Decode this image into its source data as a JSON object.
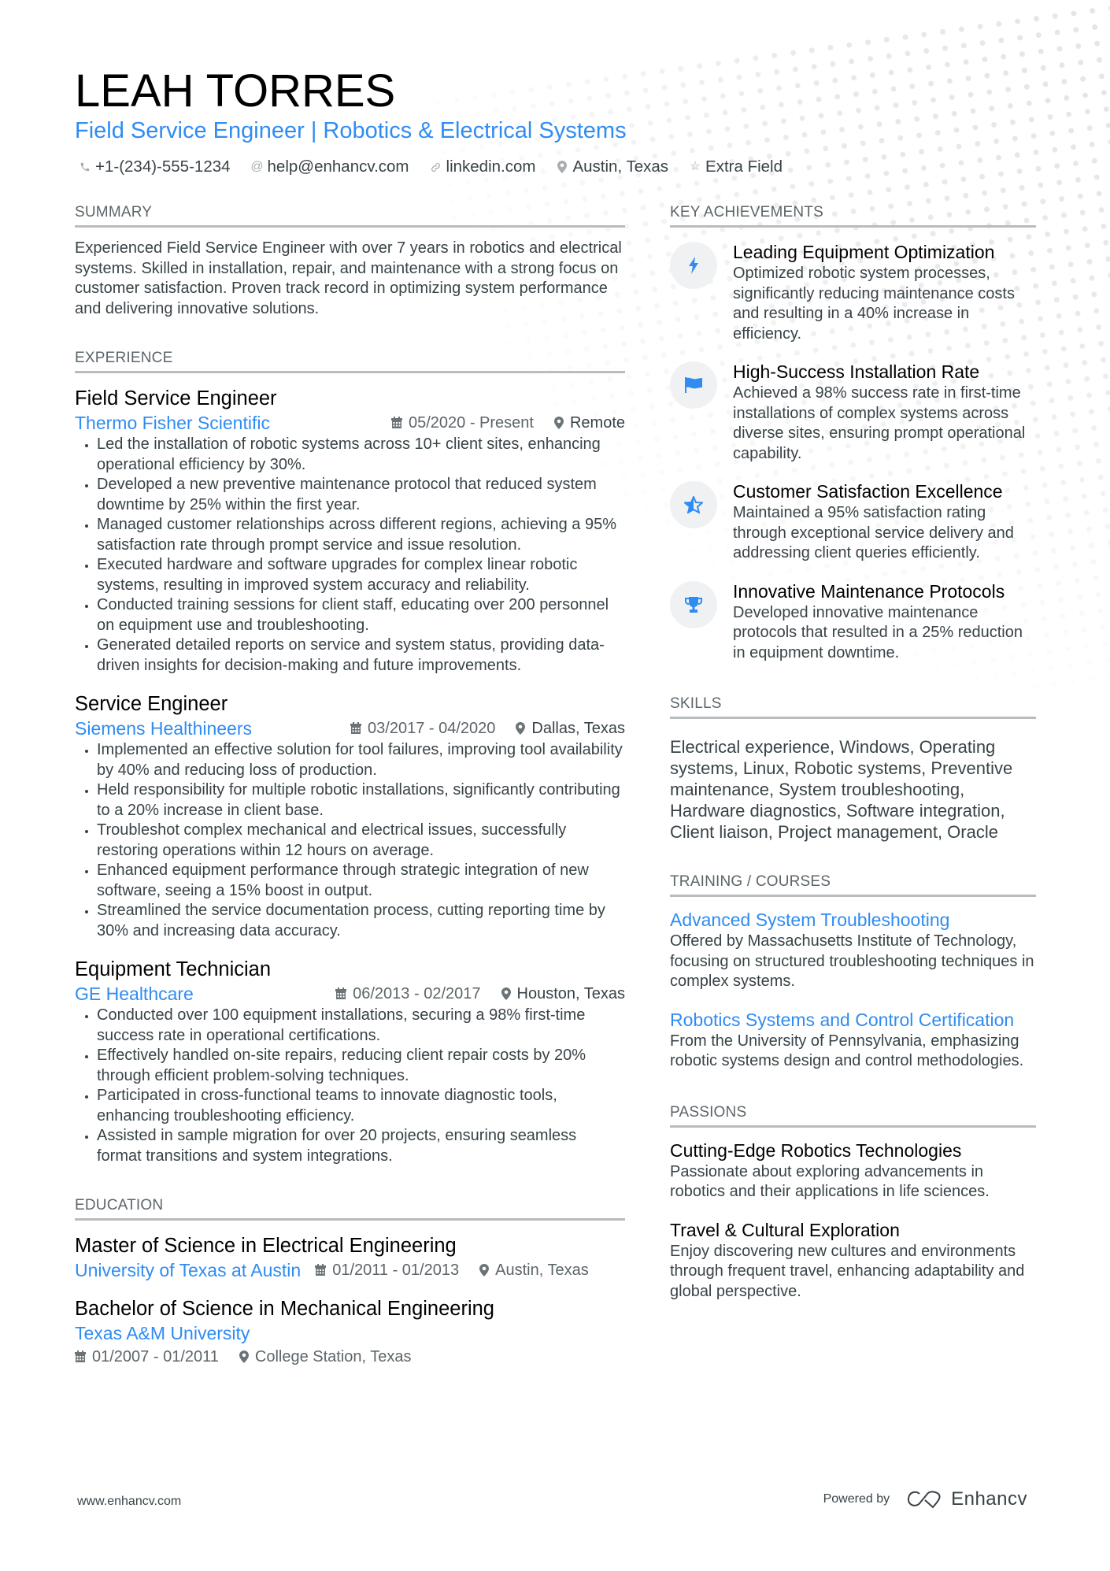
{
  "header": {
    "name": "LEAH TORRES",
    "title": "Field Service Engineer | Robotics & Electrical Systems",
    "contacts": [
      {
        "icon": "phone-icon",
        "text": "+1-(234)-555-1234"
      },
      {
        "icon": "at-icon",
        "text": "help@enhancv.com"
      },
      {
        "icon": "link-icon",
        "text": "linkedin.com"
      },
      {
        "icon": "location-pin-icon",
        "text": "Austin, Texas"
      },
      {
        "icon": "star-icon",
        "text": "Extra Field"
      }
    ]
  },
  "summary": {
    "heading": "SUMMARY",
    "text": "Experienced Field Service Engineer with over 7 years in robotics and electrical systems. Skilled in installation, repair, and maintenance with a strong focus on customer satisfaction. Proven track record in optimizing system performance and delivering innovative solutions."
  },
  "experience": {
    "heading": "EXPERIENCE",
    "jobs": [
      {
        "title": "Field Service Engineer",
        "company": "Thermo Fisher Scientific",
        "dates": "05/2020 - Present",
        "location": "Remote",
        "bullets": [
          "Led the installation of robotic systems across 10+ client sites, enhancing operational efficiency by 30%.",
          "Developed a new preventive maintenance protocol that reduced system downtime by 25% within the first year.",
          "Managed customer relationships across different regions, achieving a 95% satisfaction rate through prompt service and issue resolution.",
          "Executed hardware and software upgrades for complex linear robotic systems, resulting in improved system accuracy and reliability.",
          "Conducted training sessions for client staff, educating over 200 personnel on equipment use and troubleshooting.",
          "Generated detailed reports on service and system status, providing data-driven insights for decision-making and future improvements."
        ]
      },
      {
        "title": "Service Engineer",
        "company": "Siemens Healthineers",
        "dates": "03/2017 - 04/2020",
        "location": "Dallas, Texas",
        "bullets": [
          "Implemented an effective solution for tool failures, improving tool availability by 40% and reducing loss of production.",
          "Held responsibility for multiple robotic installations, significantly contributing to a 20% increase in client base.",
          "Troubleshot complex mechanical and electrical issues, successfully restoring operations within 12 hours on average.",
          "Enhanced equipment performance through strategic integration of new software, seeing a 15% boost in output.",
          "Streamlined the service documentation process, cutting reporting time by 30% and increasing data accuracy."
        ]
      },
      {
        "title": "Equipment Technician",
        "company": "GE Healthcare",
        "dates": "06/2013 - 02/2017",
        "location": "Houston, Texas",
        "bullets": [
          "Conducted over 100 equipment installations, securing a 98% first-time success rate in operational certifications.",
          "Effectively handled on-site repairs, reducing client repair costs by 20% through efficient problem-solving techniques.",
          "Participated in cross-functional teams to innovate diagnostic tools, enhancing troubleshooting efficiency.",
          "Assisted in sample migration for over 20 projects, ensuring seamless format transitions and system integrations."
        ]
      }
    ]
  },
  "education": {
    "heading": "EDUCATION",
    "items": [
      {
        "degree": "Master of Science in Electrical Engineering",
        "school": "University of Texas at Austin",
        "dates": "01/2011 - 01/2013",
        "location": "Austin, Texas"
      },
      {
        "degree": "Bachelor of Science in Mechanical Engineering",
        "school": "Texas A&M University",
        "dates": "01/2007 - 01/2011",
        "location": "College Station, Texas"
      }
    ]
  },
  "achievements": {
    "heading": "KEY ACHIEVEMENTS",
    "items": [
      {
        "icon": "lightning-bolt-icon",
        "title": "Leading Equipment Optimization",
        "desc": "Optimized robotic system processes, significantly reducing maintenance costs and resulting in a 40% increase in efficiency."
      },
      {
        "icon": "flag-icon",
        "title": "High-Success Installation Rate",
        "desc": "Achieved a 98% success rate in first-time installations of complex systems across diverse sites, ensuring prompt operational capability."
      },
      {
        "icon": "half-star-icon",
        "title": "Customer Satisfaction Excellence",
        "desc": "Maintained a 95% satisfaction rating through exceptional service delivery and addressing client queries efficiently."
      },
      {
        "icon": "trophy-icon",
        "title": "Innovative Maintenance Protocols",
        "desc": "Developed innovative maintenance protocols that resulted in a 25% reduction in equipment downtime."
      }
    ]
  },
  "skills": {
    "heading": "SKILLS",
    "text": "Electrical experience, Windows, Operating systems, Linux, Robotic systems, Preventive maintenance, System troubleshooting, Hardware diagnostics, Software integration, Client liaison, Project management, Oracle"
  },
  "training": {
    "heading": "TRAINING / COURSES",
    "items": [
      {
        "title": "Advanced System Troubleshooting",
        "desc": "Offered by Massachusetts Institute of Technology, focusing on structured troubleshooting techniques in complex systems."
      },
      {
        "title": "Robotics Systems and Control Certification",
        "desc": "From the University of Pennsylvania, emphasizing robotic systems design and control methodologies."
      }
    ]
  },
  "passions": {
    "heading": "PASSIONS",
    "items": [
      {
        "title": "Cutting-Edge Robotics Technologies",
        "desc": "Passionate about exploring advancements in robotics and their applications in life sciences."
      },
      {
        "title": "Travel & Cultural Exploration",
        "desc": "Enjoy discovering new cultures and environments through frequent travel, enhancing adaptability and global perspective."
      }
    ]
  },
  "footer": {
    "website": "www.enhancv.com",
    "powered_by": "Powered by",
    "brand": "Enhancv"
  },
  "colors": {
    "accent": "#2f8cf2",
    "text": "#384347",
    "heading_gray": "#5c6569",
    "rule": "#b9bcbf"
  }
}
